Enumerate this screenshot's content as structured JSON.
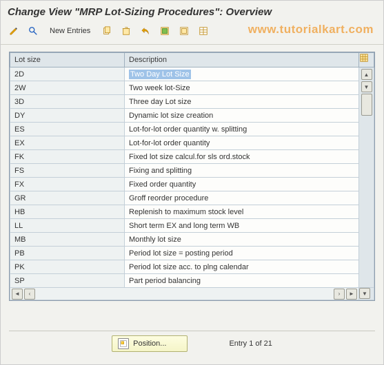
{
  "title": "Change View \"MRP Lot-Sizing Procedures\": Overview",
  "toolbar": {
    "new_entries_label": "New Entries"
  },
  "watermark": "www.tutorialkart.com",
  "table": {
    "columns": {
      "lot_size": "Lot size",
      "description": "Description"
    },
    "rows": [
      {
        "lot": "2D",
        "desc": "Two Day Lot Size",
        "selected": true
      },
      {
        "lot": "2W",
        "desc": "Two week lot-Size"
      },
      {
        "lot": "3D",
        "desc": "Three day Lot size"
      },
      {
        "lot": "DY",
        "desc": "Dynamic lot size creation"
      },
      {
        "lot": "ES",
        "desc": "Lot-for-lot order quantity w. splitting"
      },
      {
        "lot": "EX",
        "desc": "Lot-for-lot order quantity"
      },
      {
        "lot": "FK",
        "desc": "Fixed lot size calcul.for sls ord.stock"
      },
      {
        "lot": "FS",
        "desc": "Fixing and splitting"
      },
      {
        "lot": "FX",
        "desc": "Fixed order quantity"
      },
      {
        "lot": "GR",
        "desc": "Groff reorder procedure"
      },
      {
        "lot": "HB",
        "desc": "Replenish to maximum stock level"
      },
      {
        "lot": "LL",
        "desc": "Short term EX and long term WB"
      },
      {
        "lot": "MB",
        "desc": "Monthly lot size"
      },
      {
        "lot": "PB",
        "desc": "Period lot size = posting period"
      },
      {
        "lot": "PK",
        "desc": "Period lot size acc. to plng calendar"
      },
      {
        "lot": "SP",
        "desc": "Part period balancing"
      }
    ]
  },
  "footer": {
    "position_label": "Position...",
    "entry_status": "Entry 1 of 21"
  },
  "colors": {
    "selection_bg": "#9fc3e8",
    "header_bg": "#dfe6ea"
  }
}
